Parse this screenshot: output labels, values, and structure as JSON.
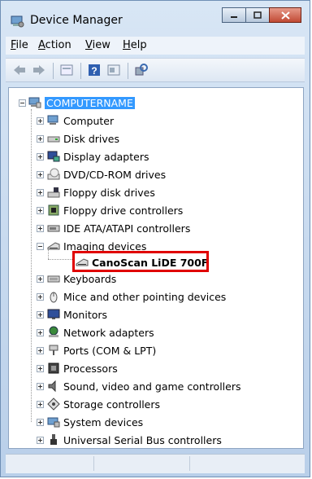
{
  "window": {
    "title": "Device Manager"
  },
  "menu": [
    "File",
    "Action",
    "View",
    "Help"
  ],
  "toolbar": {
    "buttons": [
      "back-icon",
      "forward-icon",
      "properties-icon",
      "help-icon",
      "update-driver-icon",
      "scan-hardware-icon"
    ]
  },
  "tree": {
    "root": "COMPUTERNAME",
    "categories": [
      {
        "label": "Computer",
        "icon": "computer-icon"
      },
      {
        "label": "Disk drives",
        "icon": "disk-drive-icon"
      },
      {
        "label": "Display adapters",
        "icon": "display-adapter-icon"
      },
      {
        "label": "DVD/CD-ROM drives",
        "icon": "dvd-drive-icon"
      },
      {
        "label": "Floppy disk drives",
        "icon": "floppy-drive-icon"
      },
      {
        "label": "Floppy drive controllers",
        "icon": "floppy-controller-icon"
      },
      {
        "label": "IDE ATA/ATAPI controllers",
        "icon": "ide-controller-icon"
      },
      {
        "label": "Imaging devices",
        "icon": "imaging-device-icon",
        "expanded": true,
        "children": [
          {
            "label": "CanoScan LiDE 700F",
            "icon": "scanner-icon"
          }
        ]
      },
      {
        "label": "Keyboards",
        "icon": "keyboard-icon"
      },
      {
        "label": "Mice and other pointing devices",
        "icon": "mouse-icon"
      },
      {
        "label": "Monitors",
        "icon": "monitor-icon"
      },
      {
        "label": "Network adapters",
        "icon": "network-adapter-icon"
      },
      {
        "label": "Ports (COM & LPT)",
        "icon": "port-icon"
      },
      {
        "label": "Processors",
        "icon": "processor-icon"
      },
      {
        "label": "Sound, video and game controllers",
        "icon": "sound-icon"
      },
      {
        "label": "Storage controllers",
        "icon": "storage-controller-icon"
      },
      {
        "label": "System devices",
        "icon": "system-device-icon"
      },
      {
        "label": "Universal Serial Bus controllers",
        "icon": "usb-icon"
      }
    ]
  },
  "colors": {
    "highlight": "#e00000",
    "selection": "#3399ff"
  }
}
